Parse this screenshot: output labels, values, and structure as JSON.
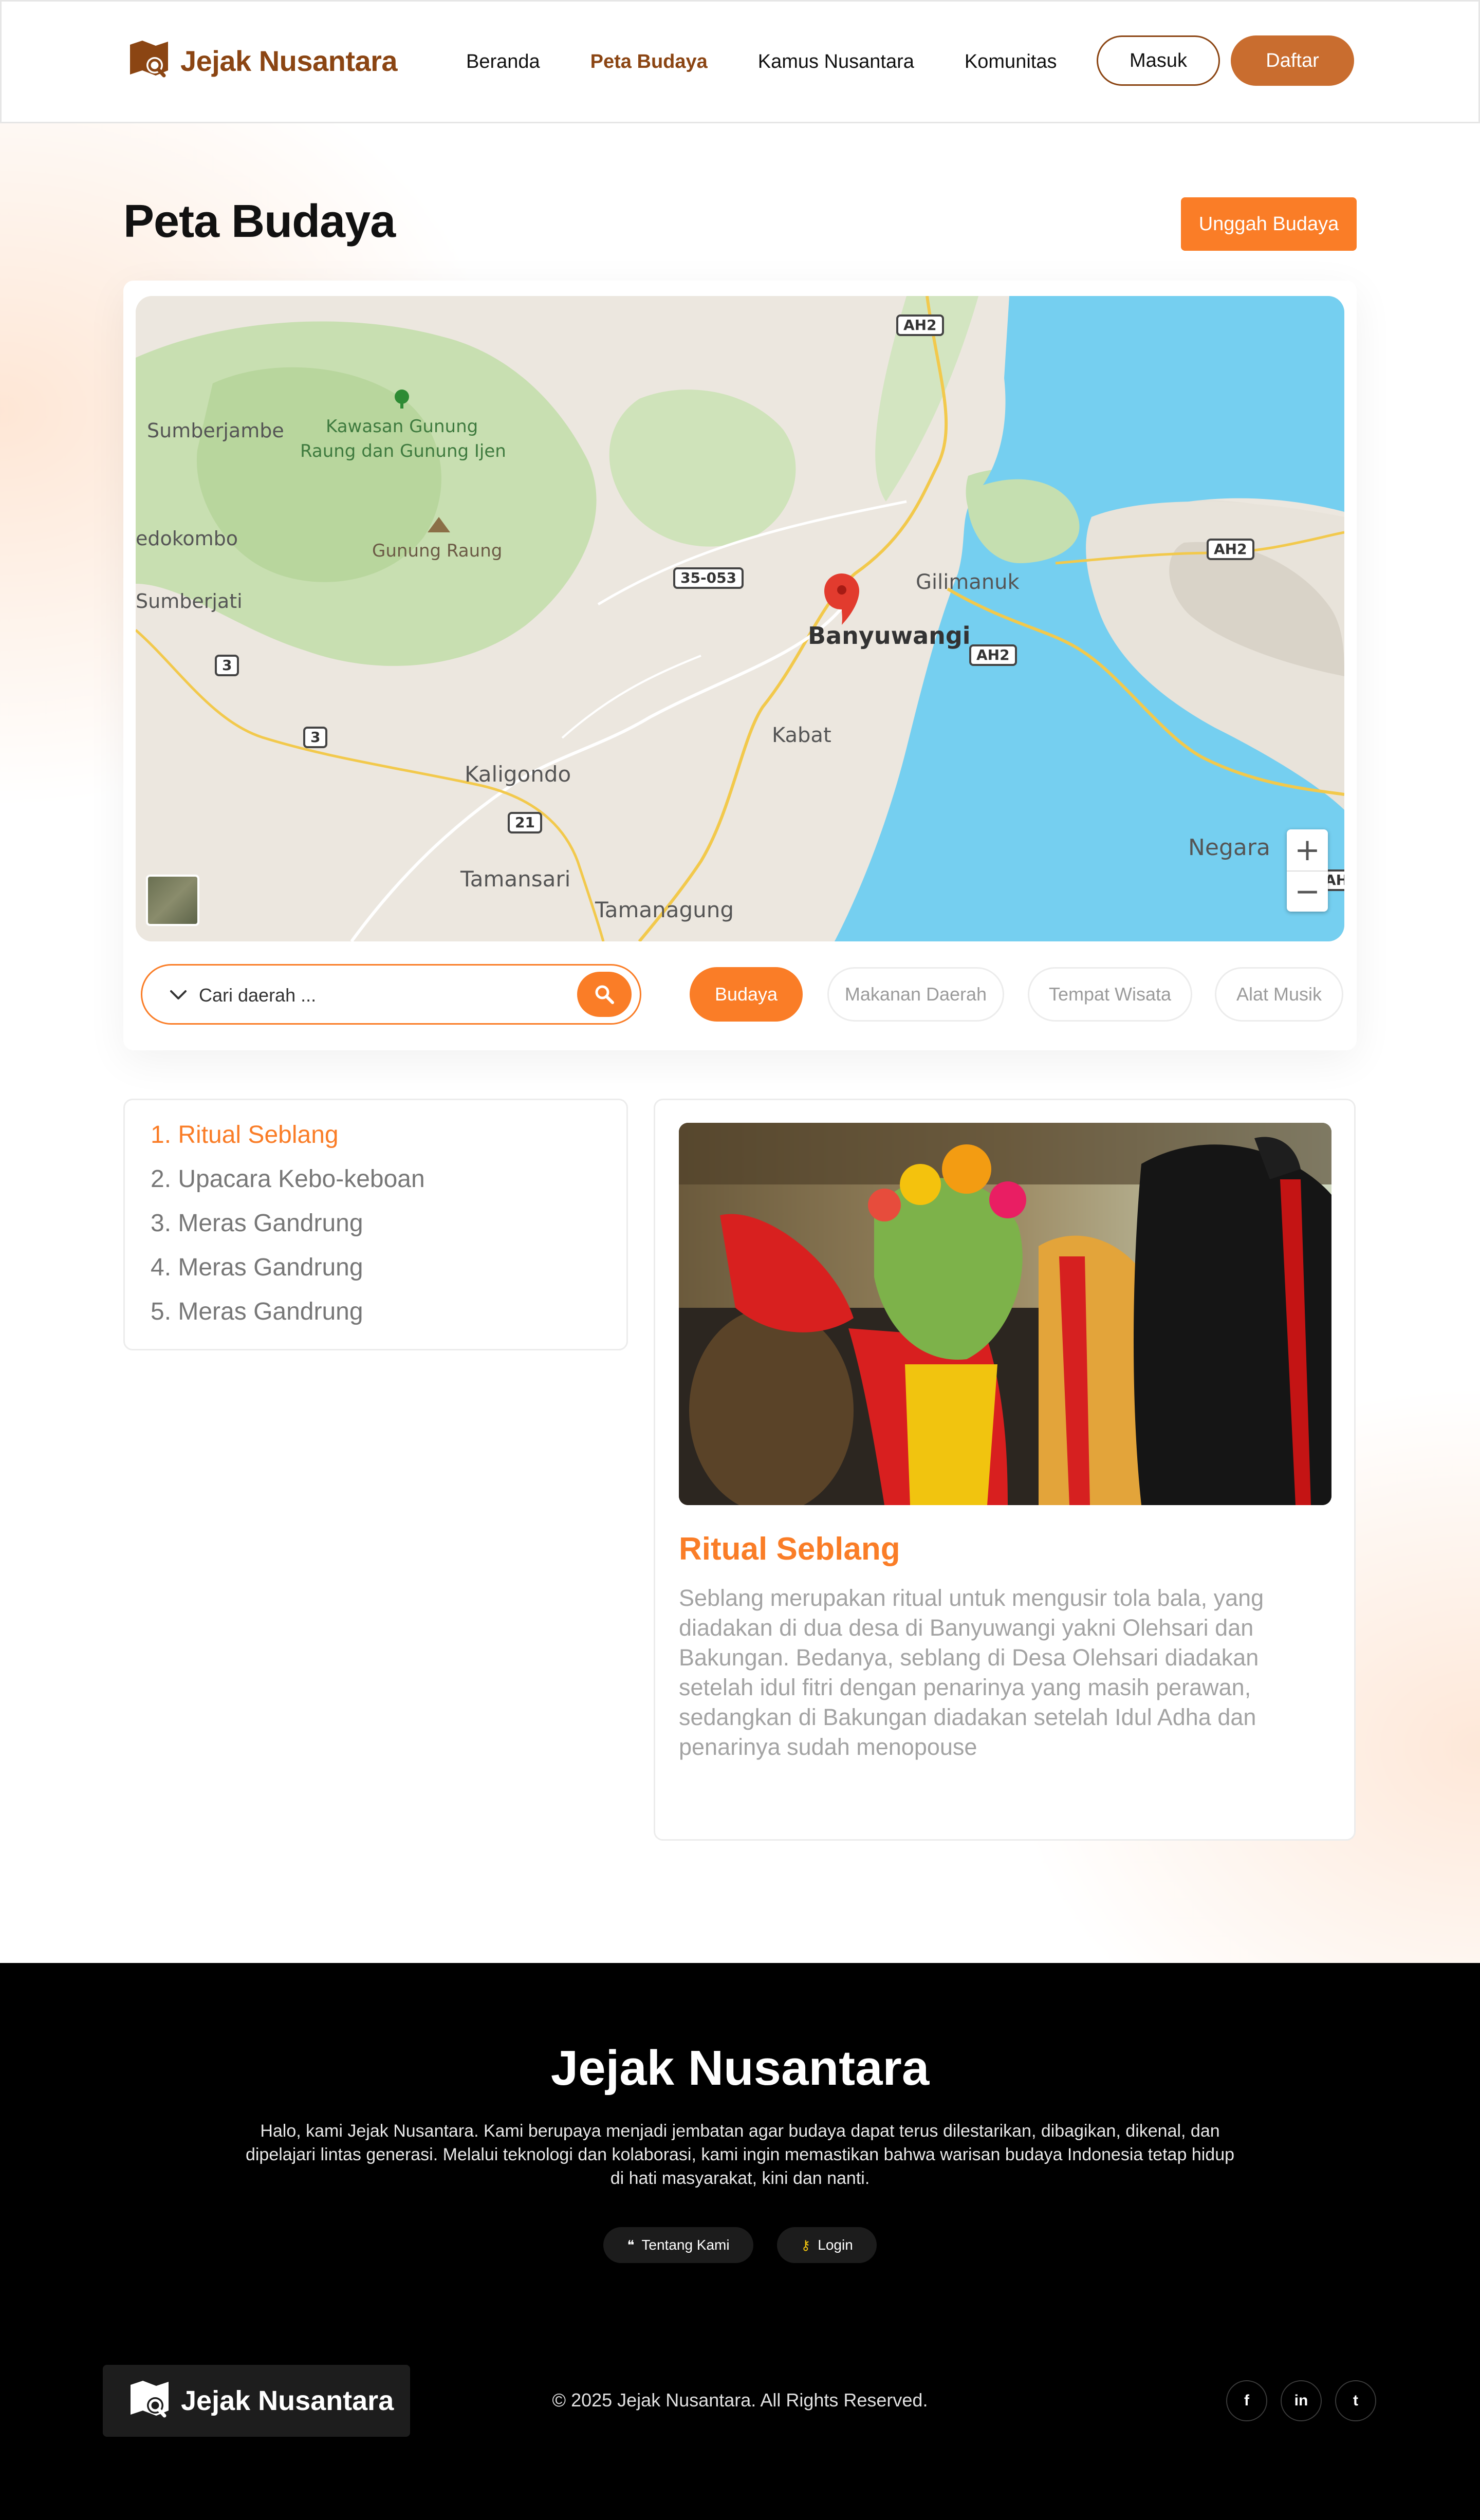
{
  "brand": {
    "name": "Jejak Nusantara",
    "color": "#8b4513",
    "accent": "#fa7d27"
  },
  "nav": {
    "items": [
      {
        "label": "Beranda",
        "active": false
      },
      {
        "label": "Peta Budaya",
        "active": true
      },
      {
        "label": "Kamus Nusantara",
        "active": false
      },
      {
        "label": "Komunitas",
        "active": false
      }
    ],
    "login_label": "Masuk",
    "register_label": "Daftar"
  },
  "page": {
    "title": "Peta Budaya",
    "upload_label": "Unggah Budaya"
  },
  "map": {
    "labels": {
      "sumberjambe": "Sumberjambe",
      "kawasan": "Kawasan Gunung",
      "kawasan2": "Raung dan Gunung Ijen",
      "gunung_raung": "Gunung Raung",
      "dedokombo": "edokombo",
      "sumberjati": "Sumberjati",
      "gilimanuk": "Gilimanuk",
      "banyuwangi": "Banyuwangi",
      "kabat": "Kabat",
      "kaligondo": "Kaligondo",
      "tamansari": "Tamansari",
      "tamanagung": "Tamanagung",
      "negara": "Negara"
    },
    "shields": [
      "AH2",
      "AH2",
      "35-053",
      "AH2",
      "3",
      "3",
      "21",
      "AH"
    ],
    "zoom_in": "+",
    "zoom_out": "−",
    "pin_icon": "map-pin-icon",
    "water_color": "#75cff0",
    "forest_color": "#c5dfb0",
    "land_color": "#ece7df"
  },
  "search": {
    "placeholder": "Cari daerah ..."
  },
  "categories": [
    {
      "label": "Budaya",
      "active": true
    },
    {
      "label": "Makanan Daerah",
      "active": false
    },
    {
      "label": "Tempat Wisata",
      "active": false
    },
    {
      "label": "Alat Musik",
      "active": false
    }
  ],
  "culture_list": [
    {
      "label": "1. Ritual Seblang",
      "active": true
    },
    {
      "label": "2. Upacara Kebo-keboan",
      "active": false
    },
    {
      "label": "3. Meras Gandrung",
      "active": false
    },
    {
      "label": "4. Meras Gandrung",
      "active": false
    },
    {
      "label": "5. Meras Gandrung",
      "active": false
    }
  ],
  "detail": {
    "title": "Ritual Seblang",
    "description": "Seblang merupakan ritual untuk mengusir tola bala, yang diadakan di dua desa di Banyuwangi yakni Olehsari dan Bakungan. Bedanya, seblang di Desa Olehsari diadakan setelah idul fitri dengan penarinya yang masih perawan, sedangkan di Bakungan diadakan setelah Idul Adha dan penarinya sudah menopouse"
  },
  "footer": {
    "title": "Jejak Nusantara",
    "about": "Halo, kami Jejak Nusantara. Kami berupaya menjadi jembatan agar budaya dapat terus dilestarikan, dibagikan, dikenal, dan dipelajari lintas generasi. Melalui teknologi dan kolaborasi, kami ingin memastikan bahwa warisan budaya Indonesia tetap hidup di hati masyarakat, kini dan nanti.",
    "links": [
      {
        "label": "Tentang Kami",
        "icon": "quote-icon"
      },
      {
        "label": "Login",
        "icon": "key-icon"
      }
    ],
    "logo_text": "Jejak Nusantara",
    "copyright": "© 2025 Jejak Nusantara. All Rights Reserved.",
    "socials": [
      {
        "label": "f",
        "icon": "facebook-icon"
      },
      {
        "label": "in",
        "icon": "linkedin-icon"
      },
      {
        "label": "t",
        "icon": "twitter-icon"
      }
    ]
  }
}
